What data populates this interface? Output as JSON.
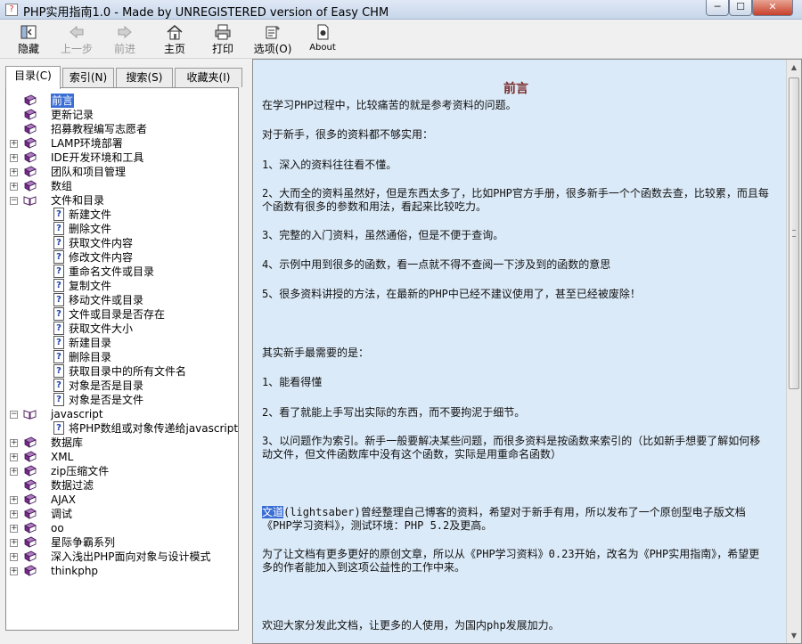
{
  "window": {
    "title": "PHP实用指南1.0 - Made by UNREGISTERED version of Easy CHM",
    "minimize_label": "─",
    "maximize_label": "☐",
    "close_label": "✕"
  },
  "toolbar": {
    "hide": "隐藏",
    "back": "上一步",
    "forward": "前进",
    "home": "主页",
    "print": "打印",
    "options": "选项(O)",
    "about": "About"
  },
  "tabs": {
    "toc": "目录(C)",
    "index": "索引(N)",
    "search": "搜索(S)",
    "favorites": "收藏夹(I)"
  },
  "tree": [
    {
      "label": "前言",
      "expander": "",
      "icon": "book",
      "selected": true
    },
    {
      "label": "更新记录",
      "expander": "",
      "icon": "book"
    },
    {
      "label": "招募教程编写志愿者",
      "expander": "",
      "icon": "book"
    },
    {
      "label": "LAMP环境部署",
      "expander": "+",
      "icon": "book"
    },
    {
      "label": "IDE开发环境和工具",
      "expander": "+",
      "icon": "book"
    },
    {
      "label": "团队和项目管理",
      "expander": "+",
      "icon": "book"
    },
    {
      "label": "数组",
      "expander": "+",
      "icon": "book"
    },
    {
      "label": "文件和目录",
      "expander": "−",
      "icon": "book-open"
    },
    {
      "label": "新建文件",
      "expander": "",
      "icon": "page",
      "child": true
    },
    {
      "label": "删除文件",
      "expander": "",
      "icon": "page",
      "child": true
    },
    {
      "label": "获取文件内容",
      "expander": "",
      "icon": "page",
      "child": true
    },
    {
      "label": "修改文件内容",
      "expander": "",
      "icon": "page",
      "child": true
    },
    {
      "label": "重命名文件或目录",
      "expander": "",
      "icon": "page",
      "child": true
    },
    {
      "label": "复制文件",
      "expander": "",
      "icon": "page",
      "child": true
    },
    {
      "label": "移动文件或目录",
      "expander": "",
      "icon": "page",
      "child": true
    },
    {
      "label": "文件或目录是否存在",
      "expander": "",
      "icon": "page",
      "child": true
    },
    {
      "label": "获取文件大小",
      "expander": "",
      "icon": "page",
      "child": true
    },
    {
      "label": "新建目录",
      "expander": "",
      "icon": "page",
      "child": true
    },
    {
      "label": "删除目录",
      "expander": "",
      "icon": "page",
      "child": true
    },
    {
      "label": "获取目录中的所有文件名",
      "expander": "",
      "icon": "page",
      "child": true
    },
    {
      "label": "对象是否是目录",
      "expander": "",
      "icon": "page",
      "child": true
    },
    {
      "label": "对象是否是文件",
      "expander": "",
      "icon": "page",
      "child": true
    },
    {
      "label": "javascript",
      "expander": "−",
      "icon": "book-open"
    },
    {
      "label": "将PHP数组或对象传递给javascript",
      "expander": "",
      "icon": "page",
      "child": true
    },
    {
      "label": "数据库",
      "expander": "+",
      "icon": "book"
    },
    {
      "label": "XML",
      "expander": "+",
      "icon": "book"
    },
    {
      "label": "zip压缩文件",
      "expander": "+",
      "icon": "book"
    },
    {
      "label": "数据过滤",
      "expander": "",
      "icon": "book"
    },
    {
      "label": "AJAX",
      "expander": "+",
      "icon": "book"
    },
    {
      "label": "调试",
      "expander": "+",
      "icon": "book"
    },
    {
      "label": "oo",
      "expander": "+",
      "icon": "book"
    },
    {
      "label": "星际争霸系列",
      "expander": "+",
      "icon": "book"
    },
    {
      "label": "深入浅出PHP面向对象与设计模式",
      "expander": "+",
      "icon": "book"
    },
    {
      "label": "thinkphp",
      "expander": "+",
      "icon": "book"
    }
  ],
  "content": {
    "title": "前言",
    "p1": "在学习PHP过程中，比较痛苦的就是参考资料的问题。",
    "p2": "对于新手，很多的资料都不够实用：",
    "p3": "1、深入的资料往往看不懂。",
    "p4": "2、大而全的资料虽然好，但是东西太多了，比如PHP官方手册，很多新手一个个函数去查，比较累，而且每个函数有很多的参数和用法，看起来比较吃力。",
    "p5": "3、完整的入门资料，虽然通俗，但是不便于查询。",
    "p6": "4、示例中用到很多的函数，看一点就不得不查阅一下涉及到的函数的意思",
    "p7": "5、很多资料讲授的方法，在最新的PHP中已经不建议使用了，甚至已经被废除！",
    "p8": "其实新手最需要的是：",
    "p9": "1、能看得懂",
    "p10": "2、看了就能上手写出实际的东西，而不要拘泥于细节。",
    "p11": "3、以问题作为索引。新手一般要解决某些问题，而很多资料是按函数来索引的（比如新手想要了解如何移动文件，但文件函数库中没有这个函数，实际是用重命名函数）",
    "author_link": "文道",
    "p12_rest": "(lightsaber)曾经整理自己博客的资料，希望对于新手有用，所以发布了一个原创型电子版文档《PHP学习资料》，测试环境：PHP 5.2及更高。",
    "p13": "为了让文档有更多更好的原创文章，所以从《PHP学习资料》0.23开始，改名为《PHP实用指南》，希望更多的作者能加入到这项公益性的工作中来。",
    "p14": "欢迎大家分发此文档，让更多的人使用，为国内php发展加力。"
  },
  "colors": {
    "content_bg": "#dbeaf8",
    "selection": "#3b6ed4",
    "title_color": "#7a2a2a",
    "book_icon": "#7a2a8a"
  }
}
